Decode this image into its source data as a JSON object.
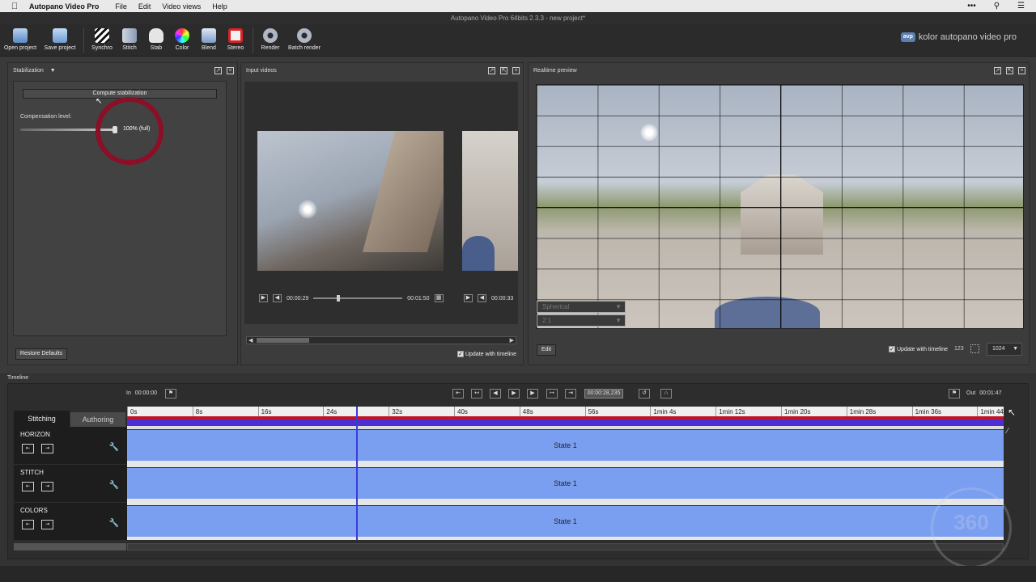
{
  "menubar": {
    "app_name": "Autopano Video Pro",
    "items": [
      "File",
      "Edit",
      "Video views",
      "Help"
    ],
    "right_icons": [
      "more-icon",
      "search-icon",
      "list-icon"
    ]
  },
  "window": {
    "title": "Autopano Video Pro 64bits 2.3.3 - new project*"
  },
  "toolbar": {
    "open_project": "Open project",
    "save_project": "Save project",
    "synchro": "Synchro",
    "stitch": "Stitch",
    "stab": "Stab",
    "color": "Color",
    "blend": "Blend",
    "stereo": "Stereo",
    "render": "Render",
    "batch_render": "Batch render",
    "brand_logo": "avp",
    "brand": "kolor autopano video pro"
  },
  "stabilization_panel": {
    "title": "Stabilization",
    "compute_button": "Compute stabilization",
    "compensation_label": "Compensation level:",
    "compensation_value": "100% (full)",
    "compensation_level": 1.0,
    "restore_defaults": "Restore Defaults"
  },
  "input_videos_panel": {
    "title": "Input videos",
    "video1_time": "00:00:29",
    "video1_duration": "00:01:50",
    "video1_progress": 0.26,
    "video2_time": "00:00:33",
    "update_timeline_label": "Update with timeline"
  },
  "preview_panel": {
    "title": "Realtime preview",
    "projection": "Spherical",
    "ratio": "2:1",
    "edit_button": "Edit",
    "update_timeline_label": "Update with timeline",
    "hint_123": "123",
    "resolution": "1024"
  },
  "timeline": {
    "title": "Timeline",
    "in_label": "In",
    "in_time": "00:00:00",
    "out_label": "Out",
    "out_time": "00:01:47",
    "current_time": "00:00:28,235",
    "tab_stitching": "Stitching",
    "tab_authoring": "Authoring",
    "ticks": [
      "0s",
      "8s",
      "16s",
      "24s",
      "32s",
      "40s",
      "48s",
      "56s",
      "1min 4s",
      "1min 12s",
      "1min 20s",
      "1min 28s",
      "1min 36s",
      "1min 44"
    ],
    "tracks": [
      {
        "name": "HORIZON",
        "state": "State 1"
      },
      {
        "name": "STITCH",
        "state": "State 1"
      },
      {
        "name": "COLORS",
        "state": "State 1"
      }
    ]
  },
  "colors": {
    "track": "#7b9ff0",
    "playhead": "#3b3bd6",
    "timebar_red": "#c0142a",
    "timebar_blue": "#4b2fd0",
    "highlight_circle": "#8b0f26"
  },
  "watermark": "360"
}
